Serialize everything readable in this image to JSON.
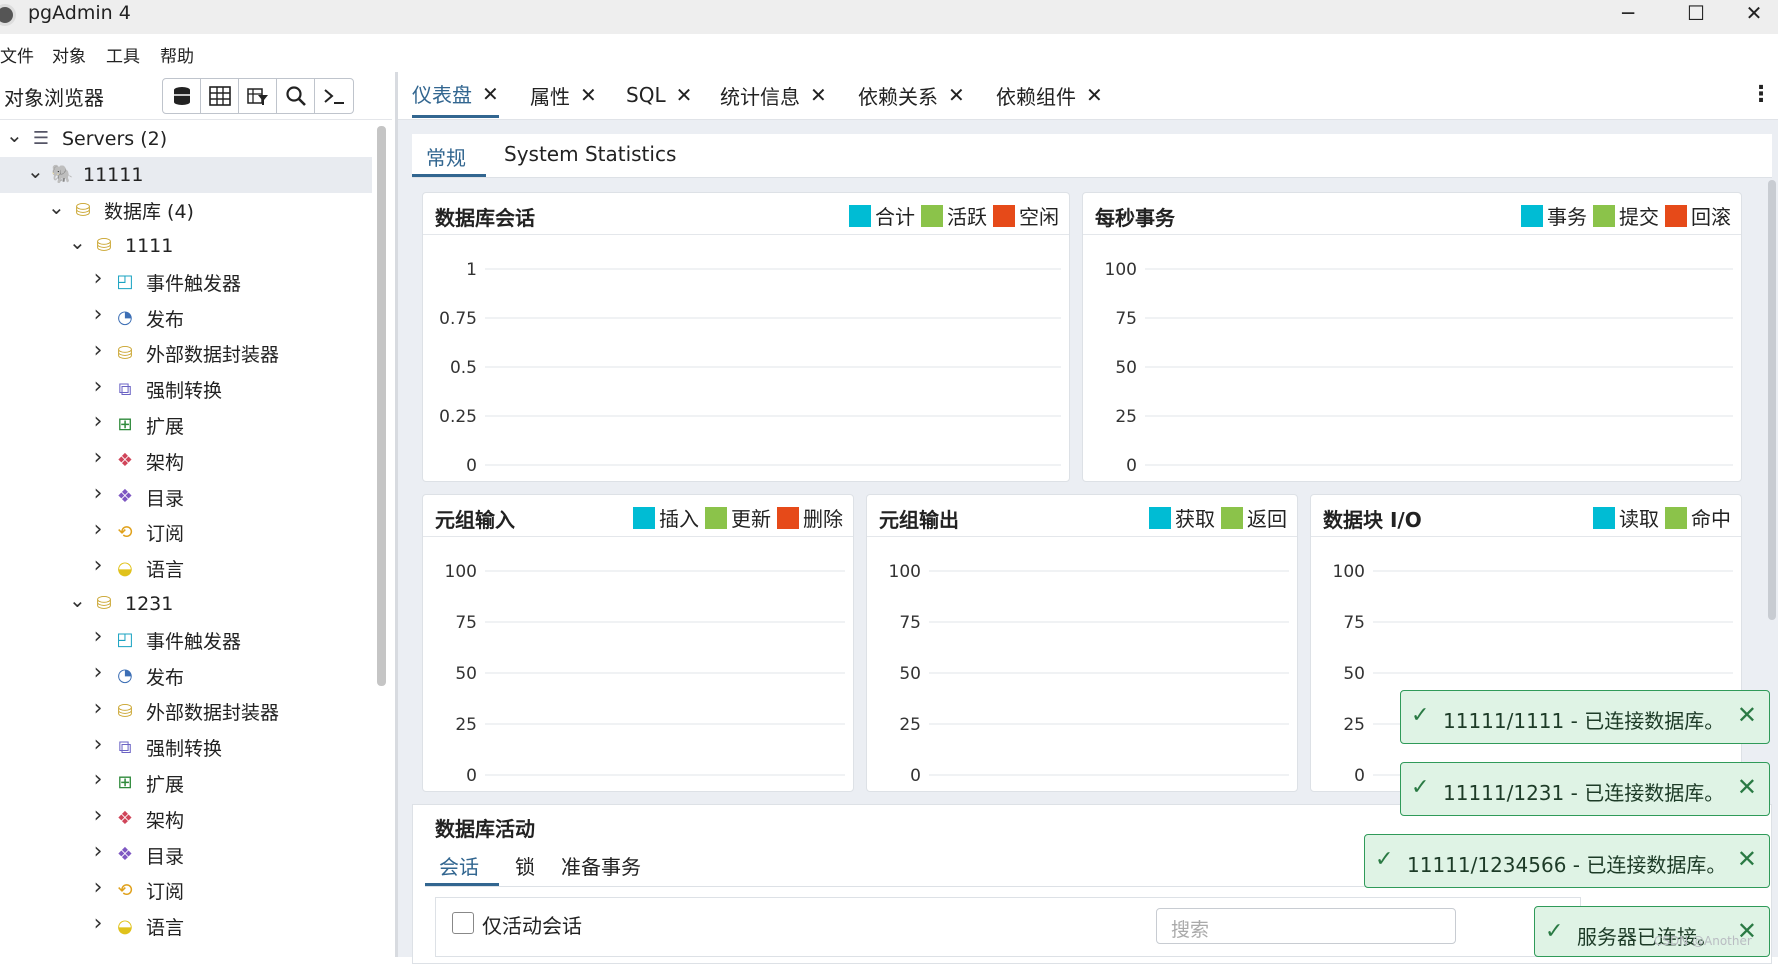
{
  "window": {
    "title": "pgAdmin 4",
    "min": "─",
    "max": "☐",
    "close": "✕"
  },
  "menu": [
    "文件",
    "对象",
    "工具",
    "帮助"
  ],
  "browser": {
    "title": "对象浏览器"
  },
  "tree": [
    {
      "label": "Servers (2)",
      "icon": "servers-icon",
      "expanded": true
    },
    {
      "label": "11111",
      "icon": "postgres-elephant-icon",
      "expanded": true
    },
    {
      "label": "数据库 (4)",
      "icon": "databases-icon",
      "expanded": true
    },
    {
      "label": "1111",
      "icon": "database-icon",
      "expanded": true
    },
    {
      "label": "事件触发器",
      "icon": "event-trigger-icon",
      "expanded": false
    },
    {
      "label": "发布",
      "icon": "publication-icon",
      "expanded": false
    },
    {
      "label": "外部数据封装器",
      "icon": "fdw-icon",
      "expanded": false
    },
    {
      "label": "强制转换",
      "icon": "cast-icon",
      "expanded": false
    },
    {
      "label": "扩展",
      "icon": "extension-icon",
      "expanded": false
    },
    {
      "label": "架构",
      "icon": "schema-icon",
      "expanded": false
    },
    {
      "label": "目录",
      "icon": "catalog-icon",
      "expanded": false
    },
    {
      "label": "订阅",
      "icon": "subscription-icon",
      "expanded": false
    },
    {
      "label": "语言",
      "icon": "language-icon",
      "expanded": false
    },
    {
      "label": "1231",
      "icon": "database-icon",
      "expanded": true
    },
    {
      "label": "事件触发器",
      "icon": "event-trigger-icon",
      "expanded": false
    },
    {
      "label": "发布",
      "icon": "publication-icon",
      "expanded": false
    },
    {
      "label": "外部数据封装器",
      "icon": "fdw-icon",
      "expanded": false
    },
    {
      "label": "强制转换",
      "icon": "cast-icon",
      "expanded": false
    },
    {
      "label": "扩展",
      "icon": "extension-icon",
      "expanded": false
    },
    {
      "label": "架构",
      "icon": "schema-icon",
      "expanded": false
    },
    {
      "label": "目录",
      "icon": "catalog-icon",
      "expanded": false
    },
    {
      "label": "订阅",
      "icon": "subscription-icon",
      "expanded": false
    },
    {
      "label": "语言",
      "icon": "language-icon",
      "expanded": false
    }
  ],
  "tabs": [
    {
      "label": "仪表盘",
      "active": true
    },
    {
      "label": "属性",
      "active": false
    },
    {
      "label": "SQL",
      "active": false
    },
    {
      "label": "统计信息",
      "active": false
    },
    {
      "label": "依赖关系",
      "active": false
    },
    {
      "label": "依赖组件",
      "active": false
    }
  ],
  "subtabs": [
    "常规",
    "System Statistics"
  ],
  "colors": {
    "blue": "#00bcd4",
    "green": "#8bc34a",
    "red": "#e64a19",
    "accent": "#326690"
  },
  "chart_data": [
    {
      "type": "line",
      "title": "数据库会话",
      "series": [
        {
          "name": "合计",
          "values": []
        },
        {
          "name": "活跃",
          "values": []
        },
        {
          "name": "空闲",
          "values": []
        }
      ],
      "yticks": [
        "1",
        "0.75",
        "0.5",
        "0.25",
        "0"
      ],
      "ylim": [
        0,
        1
      ]
    },
    {
      "type": "line",
      "title": "每秒事务",
      "series": [
        {
          "name": "事务",
          "values": []
        },
        {
          "name": "提交",
          "values": []
        },
        {
          "name": "回滚",
          "values": []
        }
      ],
      "yticks": [
        "100",
        "75",
        "50",
        "25",
        "0"
      ],
      "ylim": [
        0,
        100
      ]
    },
    {
      "type": "line",
      "title": "元组输入",
      "series": [
        {
          "name": "插入",
          "values": []
        },
        {
          "name": "更新",
          "values": []
        },
        {
          "name": "删除",
          "values": []
        }
      ],
      "yticks": [
        "100",
        "75",
        "50",
        "25",
        "0"
      ],
      "ylim": [
        0,
        100
      ]
    },
    {
      "type": "line",
      "title": "元组输出",
      "series": [
        {
          "name": "获取",
          "values": []
        },
        {
          "name": "返回",
          "values": []
        }
      ],
      "yticks": [
        "100",
        "75",
        "50",
        "25",
        "0"
      ],
      "ylim": [
        0,
        100
      ]
    },
    {
      "type": "line",
      "title": "数据块 I/O",
      "series": [
        {
          "name": "读取",
          "values": []
        },
        {
          "name": "命中",
          "values": []
        }
      ],
      "yticks": [
        "100",
        "75",
        "50",
        "25",
        "0"
      ],
      "ylim": [
        0,
        100
      ]
    }
  ],
  "activity": {
    "title": "数据库活动",
    "tabs": [
      "会话",
      "锁",
      "准备事务"
    ],
    "active_only": "仅活动会话",
    "search_placeholder": "搜索"
  },
  "toasts": [
    "11111/1111 - 已连接数据库。",
    "11111/1231 - 已连接数据库。",
    "11111/1234566 - 已连接数据库。",
    "服务器已连接。"
  ],
  "watermark": "CSDN @Another"
}
